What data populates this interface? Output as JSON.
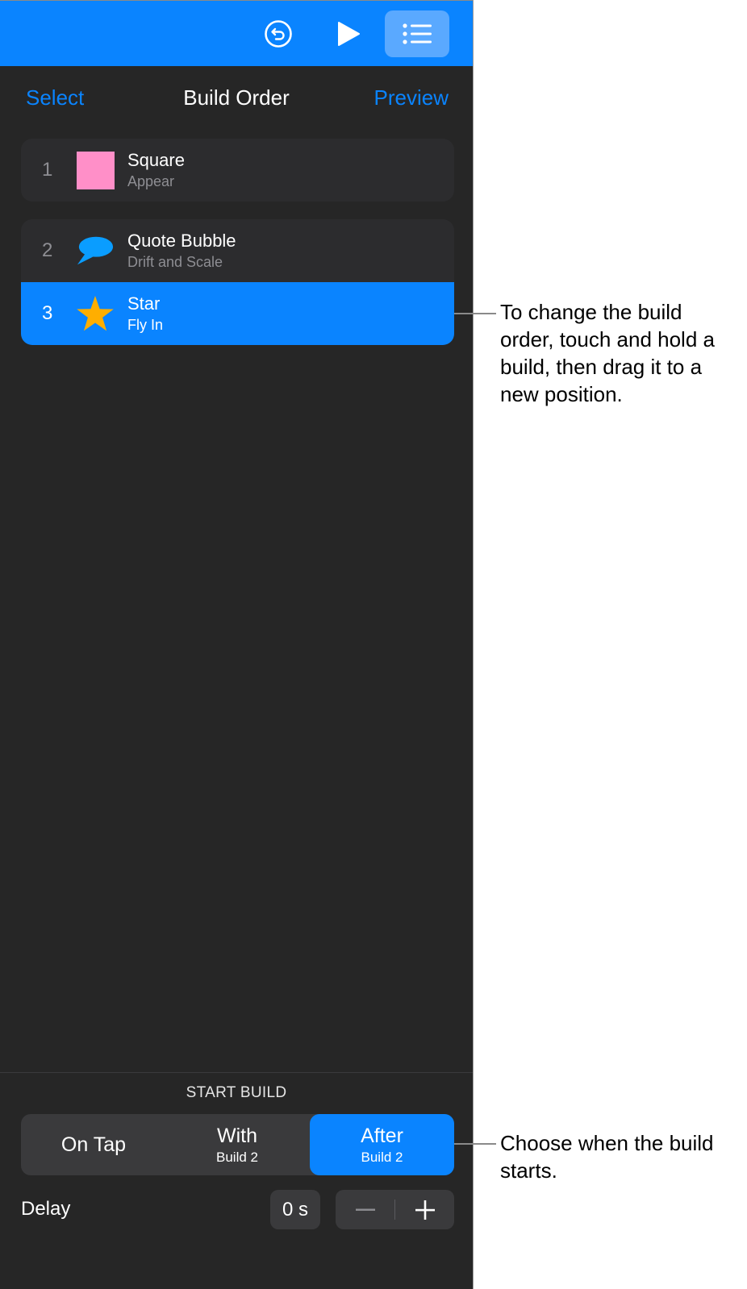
{
  "toolbar": {
    "icons": [
      "undo-icon",
      "play-icon",
      "list-icon"
    ],
    "accent": "#0a84ff"
  },
  "nav": {
    "select_label": "Select",
    "title": "Build Order",
    "preview_label": "Preview"
  },
  "builds": [
    {
      "number": "1",
      "title": "Square",
      "effect": "Appear",
      "icon": "pink-square",
      "color": "#ff8fc8",
      "selected": false
    },
    {
      "number": "2",
      "title": "Quote Bubble",
      "effect": "Drift and Scale",
      "icon": "speech-bubble",
      "color": "#0a9dff",
      "selected": false
    },
    {
      "number": "3",
      "title": "Star",
      "effect": "Fly In",
      "icon": "star",
      "color": "#ffae00",
      "selected": true
    }
  ],
  "start_build": {
    "label": "START BUILD",
    "options": [
      {
        "main": "On Tap",
        "sub": ""
      },
      {
        "main": "With",
        "sub": "Build 2"
      },
      {
        "main": "After",
        "sub": "Build 2"
      }
    ],
    "selected": "After"
  },
  "delay": {
    "label": "Delay",
    "value": "0 s",
    "decrement": "−",
    "increment": "+"
  },
  "callouts": [
    {
      "text": "To change the build order, touch and hold a build, then drag it to a new position."
    },
    {
      "text": "Choose when the build starts."
    }
  ]
}
